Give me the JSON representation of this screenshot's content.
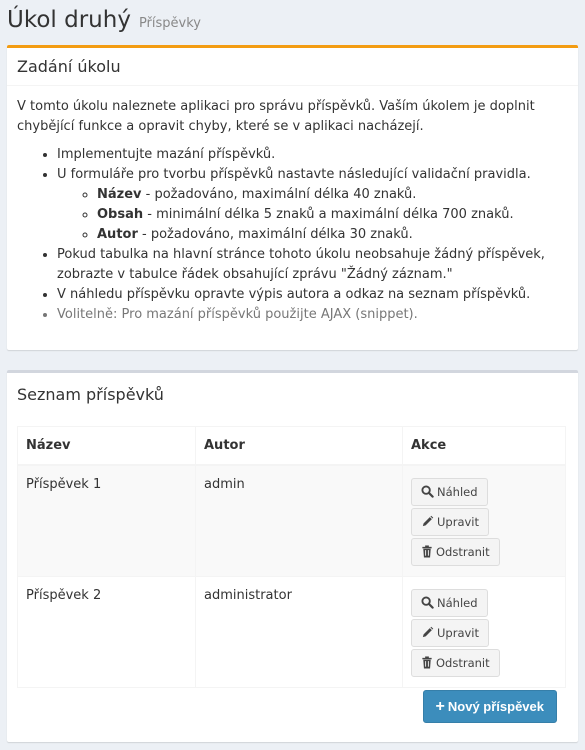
{
  "header": {
    "title": "Úkol druhý",
    "subtitle": "Příspěvky"
  },
  "assignment": {
    "title": "Zadání úkolu",
    "intro": "V tomto úkolu naleznete aplikaci pro správu příspěvků. Vaším úkolem je doplnit chybějící funkce a opravit chyby, které se v aplikaci nacházejí.",
    "item1": "Implementujte mazání příspěvků.",
    "item2": "U formuláře pro tvorbu příspěvků nastavte následující validační pravidla.",
    "rules": [
      {
        "field": "Název",
        "text": " - požadováno, maximální délka 40 znaků."
      },
      {
        "field": "Obsah",
        "text": " - minimální délka 5 znaků a maximální délka 700 znaků."
      },
      {
        "field": "Autor",
        "text": " - požadováno, maximální délka 30 znaků."
      }
    ],
    "item3": "Pokud tabulka na hlavní stránce tohoto úkolu neobsahuje žádný příspěvek, zobrazte v tabulce řádek obsahující zprávu \"Žádný záznam.\"",
    "item4": "V náhledu příspěvku opravte výpis autora a odkaz na seznam příspěvků.",
    "item5": "Volitelně: Pro mazání příspěvků použijte AJAX (snippet)."
  },
  "list": {
    "title": "Seznam příspěvků",
    "columns": {
      "name": "Název",
      "author": "Autor",
      "actions": "Akce"
    },
    "rows": [
      {
        "name": "Příspěvek 1",
        "author": "admin"
      },
      {
        "name": "Příspěvek 2",
        "author": "administrator"
      }
    ],
    "actions": {
      "view": "Náhled",
      "edit": "Upravit",
      "delete": "Odstranit"
    },
    "new_button": "Nový příspěvek"
  },
  "colors": {
    "warning_accent": "#f39c12",
    "primary": "#3c8dbc",
    "background": "#ecf0f5"
  },
  "icons": {
    "view": "search-icon",
    "edit": "pencil-icon",
    "delete": "trash-icon",
    "new": "plus-icon"
  }
}
